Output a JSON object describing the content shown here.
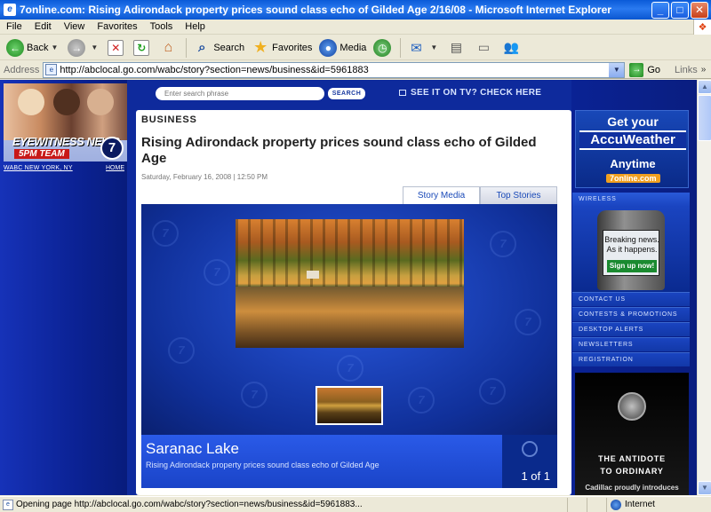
{
  "window": {
    "title": "7online.com: Rising Adirondack property prices sound class echo of Gilded Age 2/16/08 - Microsoft Internet Explorer",
    "min": "_",
    "max": "□",
    "close": "✕"
  },
  "menu": [
    "File",
    "Edit",
    "View",
    "Favorites",
    "Tools",
    "Help"
  ],
  "toolbar": {
    "back": "Back",
    "search": "Search",
    "favorites": "Favorites",
    "media": "Media"
  },
  "address": {
    "label": "Address",
    "url": "http://abclocal.go.com/wabc/story?section=news/business&id=5961883",
    "go": "Go",
    "links": "Links"
  },
  "site": {
    "promo_title": "EYEWITNESS NEWS",
    "promo_sub": "5PM TEAM",
    "promo_channel": "7",
    "station": "WABC NEW YORK, NY",
    "home": "HOME",
    "search_placeholder": "Enter search phrase",
    "search_button": "SEARCH",
    "tv_link": "SEE IT ON TV? CHECK HERE"
  },
  "article": {
    "section": "BUSINESS",
    "headline": "Rising Adirondack property prices sound class echo of Gilded Age",
    "dateline": "Saturday, February 16, 2008 | 12:50 PM",
    "tabs": [
      {
        "label": "Story Media",
        "active": true
      },
      {
        "label": "Top Stories",
        "active": false
      }
    ],
    "caption_title": "Saranac Lake",
    "caption_sub": "Rising Adirondack property prices sound class echo of Gilded Age",
    "counter": "1 of 1"
  },
  "sidebar": {
    "accuweather": {
      "line1": "Get your",
      "line2": "AccuWeather",
      "line3": "Anytime",
      "line4": "7online.com"
    },
    "wireless_head": "WIRELESS",
    "phone_text": "Breaking news. As it happens.",
    "phone_button": "Sign up now!",
    "links": [
      "CONTACT US",
      "CONTESTS & PROMOTIONS",
      "DESKTOP ALERTS",
      "NEWSLETTERS",
      "REGISTRATION"
    ],
    "cadillac": {
      "line1": "THE ANTIDOTE",
      "line2": "TO ORDINARY",
      "line3": "Cadillac proudly introduces"
    }
  },
  "status": {
    "text": "Opening page http://abclocal.go.com/wabc/story?section=news/business&id=5961883...",
    "zone": "Internet"
  }
}
